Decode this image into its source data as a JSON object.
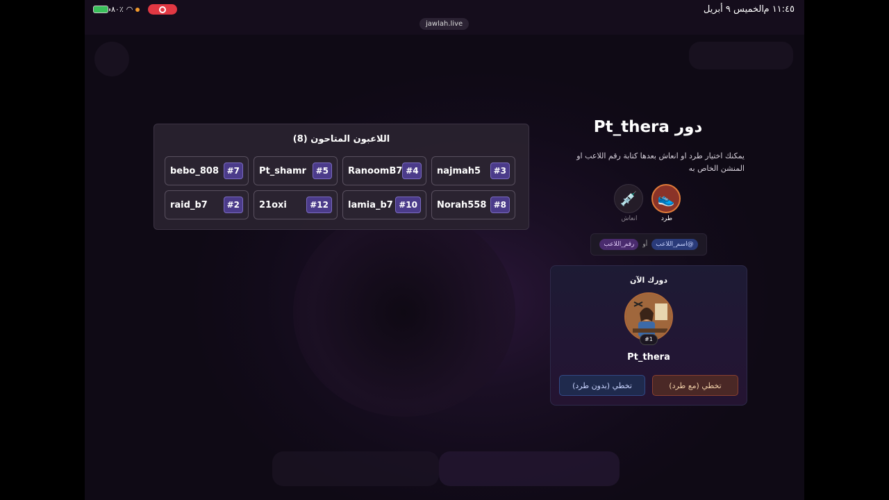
{
  "statusbar": {
    "time": "١١:٤٥ م",
    "date": "الخميس ٩ أبريل",
    "battery_pct": "٨٠٪",
    "url": "jawlah.live"
  },
  "players_panel": {
    "title": "اللاعبون المتاحون (8)",
    "players": [
      {
        "name": "najmah5",
        "num": "#3"
      },
      {
        "name": "RanoomB7",
        "num": "#4"
      },
      {
        "name": "Pt_shamr",
        "num": "#5"
      },
      {
        "name": "bebo_808",
        "num": "#7"
      },
      {
        "name": "Norah558",
        "num": "#8"
      },
      {
        "name": "lamia_b7",
        "num": "#10"
      },
      {
        "name": "21oxi",
        "num": "#12"
      },
      {
        "name": "raid_b7",
        "num": "#2"
      }
    ]
  },
  "turn": {
    "title": "دور Pt_thera",
    "description": "يمكنك اختيار طرد او انعاش بعدها كتابة رقم اللاعب او المنشن الخاص به",
    "actions": {
      "kick_label": "طرد",
      "revive_label": "انعاش",
      "kick_icon": "shoe-icon",
      "revive_icon": "syringe-icon"
    },
    "hint": {
      "mention_tag": "@اسم_اللاعب",
      "or": "أو",
      "number_tag": "رقم_اللاعب"
    }
  },
  "now_card": {
    "title": "دورك الآن",
    "rank": "#1",
    "player_name": "Pt_thera",
    "skip_with_kick": "تخطي (مع طرد)",
    "skip_without_kick": "تخطي (بدون طرد)"
  }
}
